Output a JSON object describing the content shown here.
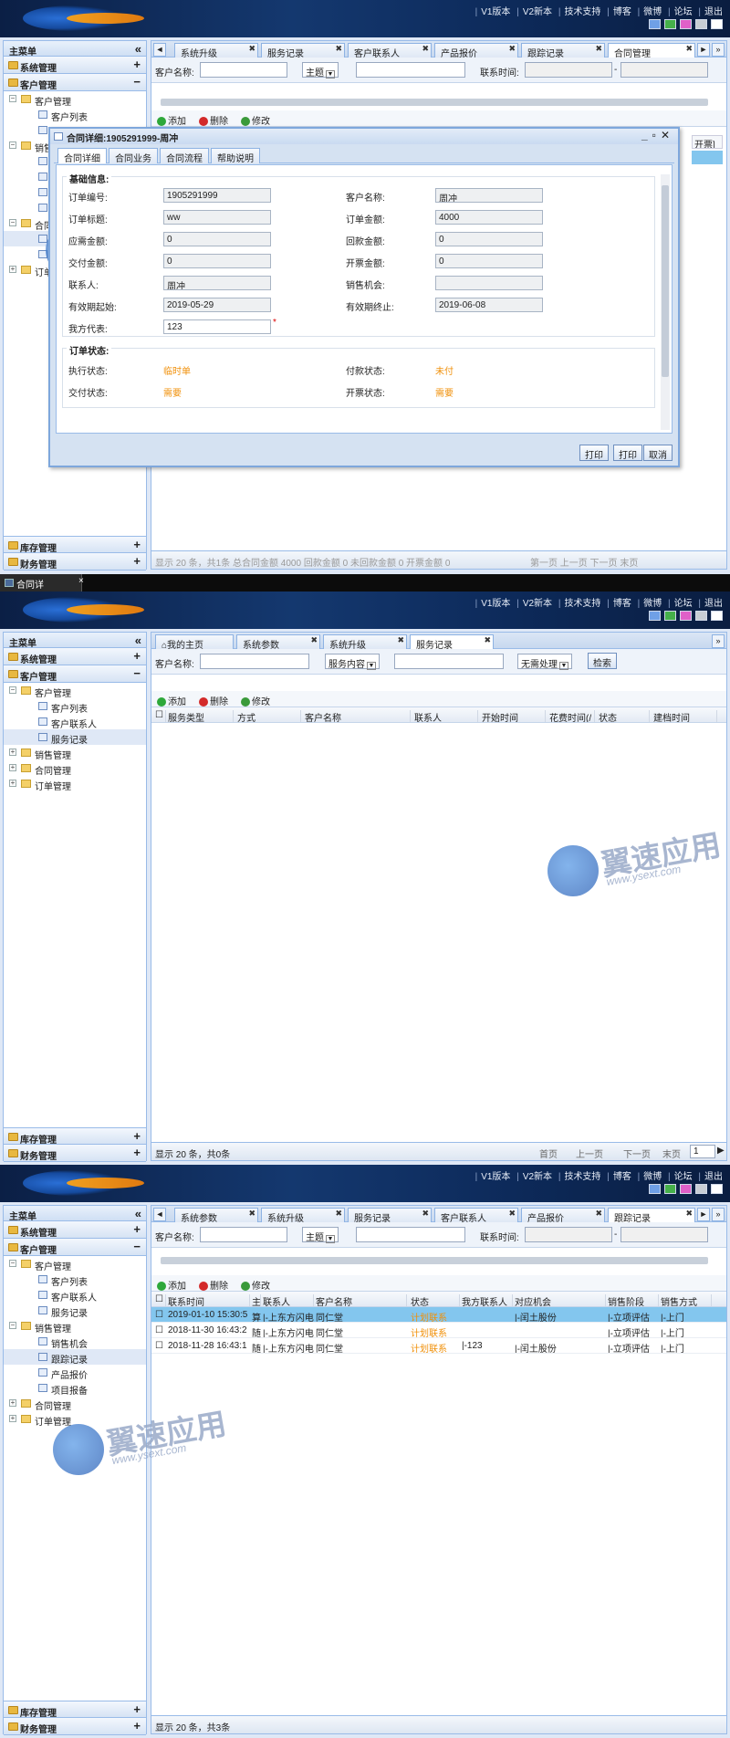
{
  "header": {
    "links": [
      "V1版本",
      "V2新本",
      "技术支持",
      "博客",
      "微博",
      "论坛",
      "退出"
    ],
    "skins": [
      "#6fa0e6",
      "#46b04a",
      "#e060c8",
      "#c8cdd4",
      "#ffffff"
    ]
  },
  "sidebar": {
    "title": "主菜单",
    "system": "系统管理",
    "customer": "客户管理",
    "inventory": "库存管理",
    "finance": "财务管理"
  },
  "tree": {
    "customer_mgmt": "客户管理",
    "customer_list": "客户列表",
    "customer_contact": "客户联系人",
    "service_record": "服务记录",
    "sales_mgmt": "销售管理",
    "sales_opportunity": "销售机会",
    "follow_record": "跟踪记录",
    "product_quote": "产品报价",
    "project_report": "项目报备",
    "contract_mgmt": "合同管理",
    "order_mgmt": "订单管理"
  },
  "screen1": {
    "tabs": [
      "系统升级",
      "服务记录",
      "客户联系人",
      "产品报价",
      "跟踪记录",
      "合同管理"
    ],
    "customer_label": "客户名称:",
    "topic": "主题",
    "contact_time": "联系时间:",
    "dash": "-",
    "add": "添加",
    "delete": "删除",
    "edit": "修改",
    "right_header": "开票]",
    "pager_left": "显示 20 条，共1条 总合同金额 4000 回款金额 0 未回款金额 0 开票金额 0",
    "pager_right": "第一页 上一页 下一页 末页"
  },
  "dialog": {
    "title": "合同详细:1905291999-周冲",
    "tabs": [
      "合同详细",
      "合同业务",
      "合同流程",
      "帮助说明"
    ],
    "basic": "基础信息:",
    "order_status_title": "订单状态:",
    "fields": {
      "order_no_label": "订单编号:",
      "order_no": "1905291999",
      "customer_label": "客户名称:",
      "customer": "周冲",
      "order_title_label": "订单标题:",
      "order_title": "ww",
      "order_amount_label": "订单金额:",
      "order_amount": "4000",
      "due_label": "应需金额:",
      "due": "0",
      "received_label": "回款金额:",
      "received": "0",
      "delivered_label": "交付金额:",
      "delivered": "0",
      "invoiced_label": "开票金额:",
      "invoiced": "0",
      "contact_label": "联系人:",
      "contact": "周冲",
      "opportunity_label": "销售机会:",
      "opportunity": "",
      "start_label": "有效期起始:",
      "start": "2019-05-29",
      "end_label": "有效期终止:",
      "end": "2019-06-08",
      "rep_label": "我方代表:",
      "rep": "123",
      "required": "*"
    },
    "status": {
      "exec_label": "执行状态:",
      "exec": "临时单",
      "pay_label": "付款状态:",
      "pay": "未付",
      "delivery_label": "交付状态:",
      "delivery": "需要",
      "invoice_label": "开票状态:",
      "invoice": "需要"
    },
    "buttons": [
      "打印",
      "打印",
      "取消"
    ]
  },
  "taskbar": {
    "title": "合同详",
    "close": "×"
  },
  "screen2": {
    "tabs": [
      "我的主页",
      "系统参数",
      "系统升级",
      "服务记录"
    ],
    "customer_label": "客户名称:",
    "content": "服务内容",
    "no_need": "无需处理",
    "search": "检索",
    "add": "添加",
    "delete": "删除",
    "edit": "修改",
    "columns": [
      "服务类型",
      "方式",
      "客户名称",
      "联系人",
      "开始时间",
      "花费时间(/",
      "状态",
      "建档时间"
    ],
    "pager_left": "显示 20 条，共0条",
    "pager_right": [
      "首页",
      "上一页",
      "下一页",
      "末页"
    ],
    "page": "1"
  },
  "screen3": {
    "tabs": [
      "系统参数",
      "系统升级",
      "服务记录",
      "客户联系人",
      "产品报价",
      "跟踪记录"
    ],
    "customer_label": "客户名称:",
    "topic": "主题",
    "contact_time": "联系时间:",
    "dash": "-",
    "add": "添加",
    "delete": "删除",
    "edit": "修改",
    "columns": [
      "联系时间",
      "主",
      "联系人",
      "客户名称",
      "状态",
      "我方联系人",
      "对应机会",
      "销售阶段",
      "销售方式"
    ],
    "rows": [
      [
        "2019-01-10 15:30:5",
        "算",
        "|-上东方闪电",
        "同仁堂",
        "计划联系",
        "",
        "|-闰土股份",
        "|-立项评估",
        "|-上门"
      ],
      [
        "2018-11-30 16:43:2",
        "随",
        "|-上东方闪电",
        "同仁堂",
        "计划联系",
        "",
        "",
        "|-立项评估",
        "|-上门"
      ],
      [
        "2018-11-28 16:43:1",
        "随",
        "|-上东方闪电",
        "同仁堂",
        "计划联系",
        "|-123",
        "|-闰土股份",
        "|-立项评估",
        "|-上门"
      ]
    ],
    "pager_left": "显示 20 条，共3条"
  },
  "watermark": {
    "brand": "翼速应用",
    "url": "www.ysext.com"
  }
}
